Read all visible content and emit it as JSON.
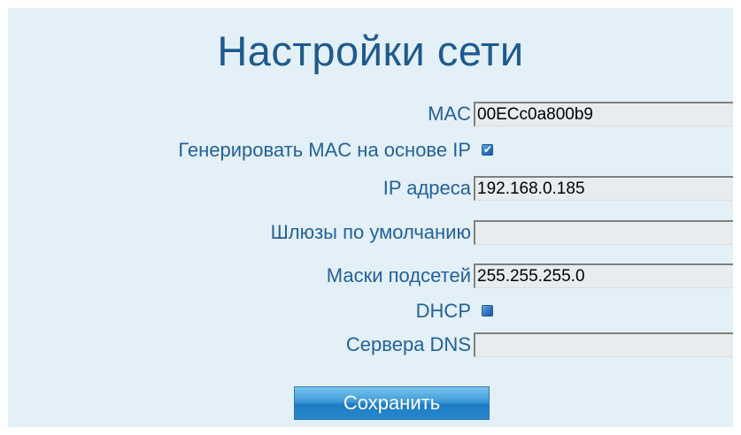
{
  "page": {
    "title": "Настройки сети"
  },
  "fields": {
    "mac": {
      "label": "MAC",
      "value": "00ECc0a800b9"
    },
    "gen_mac": {
      "label": "Генерировать MAC на основе IP",
      "checked": true
    },
    "ip": {
      "label": "IP адреса",
      "value": "192.168.0.185"
    },
    "gateway": {
      "label": "Шлюзы по умолчанию",
      "value": ""
    },
    "netmask": {
      "label": "Маски подсетей",
      "value": "255.255.255.0"
    },
    "dhcp": {
      "label": "DHCP",
      "checked": false
    },
    "dns": {
      "label": "Сервера DNS",
      "value": ""
    }
  },
  "actions": {
    "save_label": "Сохранить"
  },
  "colors": {
    "panel_bg": "#e4f0f7",
    "title": "#1e5a8e",
    "label": "#23619a",
    "accent": "#2e74bf"
  }
}
